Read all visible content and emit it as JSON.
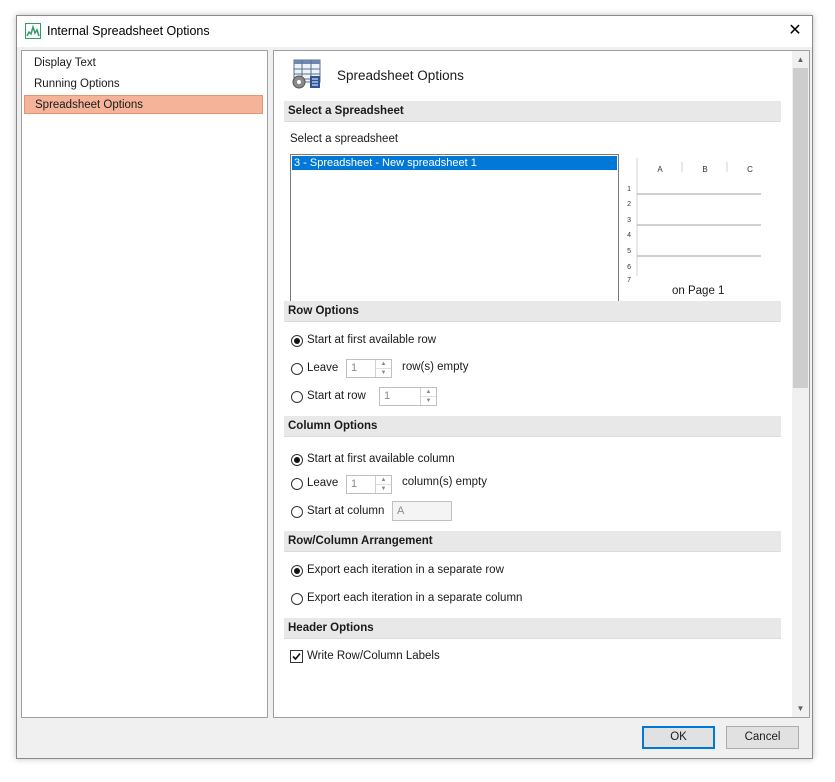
{
  "window": {
    "title": "Internal Spreadsheet Options",
    "close_glyph": "✕"
  },
  "nav": {
    "items": [
      "Display Text",
      "Running Options",
      "Spreadsheet Options"
    ],
    "selected_index": 2
  },
  "header": {
    "title": "Spreadsheet Options",
    "icon": "spreadsheet-settings-icon"
  },
  "select_section": {
    "heading": "Select a Spreadsheet",
    "label": "Select a spreadsheet",
    "items": [
      "3 - Spreadsheet - New spreadsheet 1"
    ],
    "preview": {
      "columns": [
        "A",
        "B",
        "C"
      ],
      "rows": [
        "1",
        "2",
        "3",
        "4",
        "5",
        "6",
        "7"
      ],
      "caption": "on Page 1"
    }
  },
  "row_options": {
    "heading": "Row Options",
    "first_label": "Start at first available row",
    "leave_label": "Leave",
    "leave_value": "1",
    "leave_suffix": "row(s) empty",
    "start_label": "Start at row",
    "start_value": "1",
    "selected": "first"
  },
  "column_options": {
    "heading": "Column Options",
    "first_label": "Start at first available column",
    "leave_label": "Leave",
    "leave_value": "1",
    "leave_suffix": "column(s) empty",
    "start_label": "Start at column",
    "start_value": "A",
    "selected": "first"
  },
  "arrangement": {
    "heading": "Row/Column Arrangement",
    "row_label": "Export each iteration in a separate row",
    "column_label": "Export each iteration in a separate column",
    "selected": "row"
  },
  "header_options": {
    "heading": "Header Options",
    "labels_label": "Write Row/Column Labels",
    "labels_checked": true
  },
  "buttons": {
    "ok": "OK",
    "cancel": "Cancel"
  },
  "colors": {
    "selection": "#f5b49a",
    "list_highlight": "#0078d7",
    "default_button_border": "#0078d7"
  }
}
